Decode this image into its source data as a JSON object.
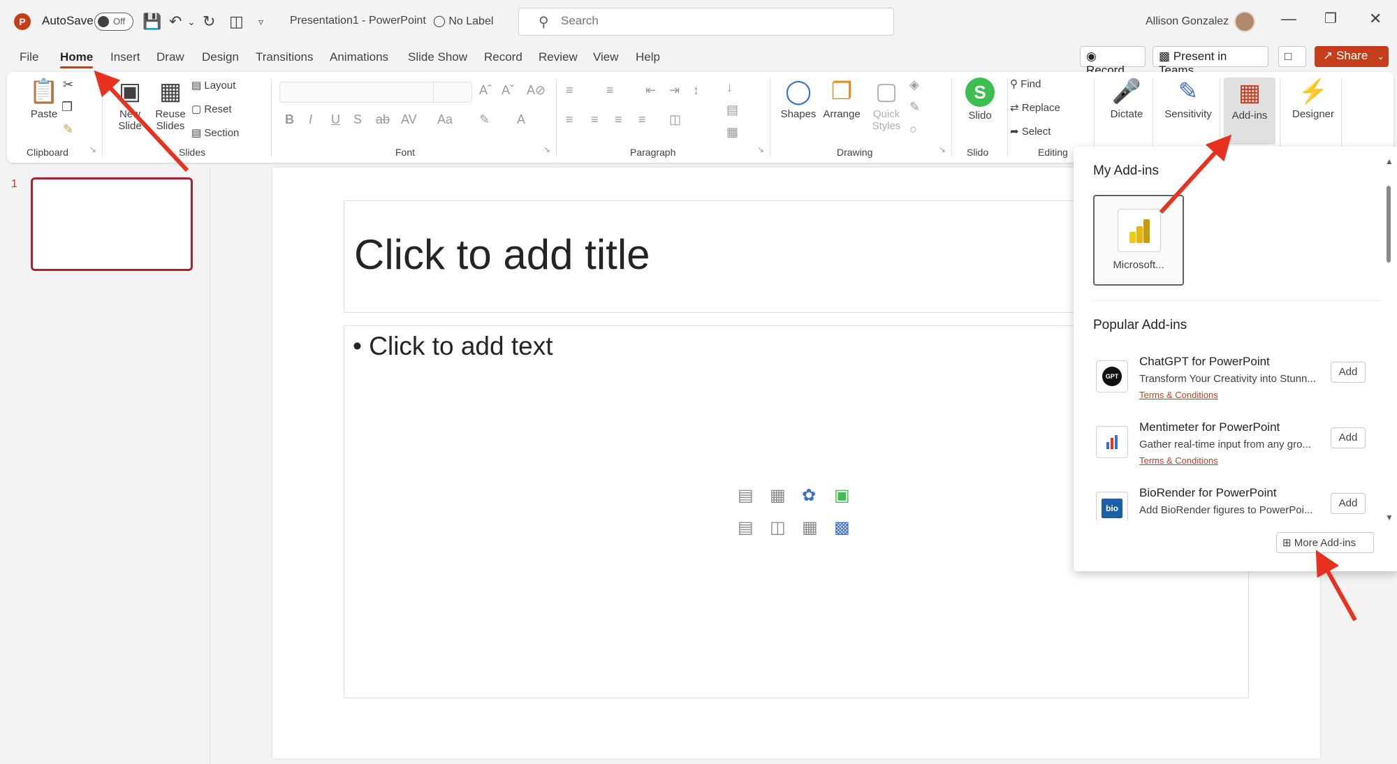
{
  "titlebar": {
    "app_logo": "P",
    "autosave_label": "AutoSave",
    "autosave_state": "Off",
    "doc_title": "Presentation1  -  PowerPoint",
    "sensitivity_label": "No Label",
    "search_placeholder": "Search",
    "user_name": "Allison Gonzalez"
  },
  "menu": {
    "tabs": [
      "File",
      "Home",
      "Insert",
      "Draw",
      "Design",
      "Transitions",
      "Animations",
      "Slide Show",
      "Record",
      "Review",
      "View",
      "Help"
    ],
    "active_tab": "Home",
    "record_label": "Record",
    "present_teams_label": "Present in Teams",
    "share_label": "Share"
  },
  "ribbon": {
    "clipboard": {
      "paste": "Paste",
      "group": "Clipboard"
    },
    "slides": {
      "new_slide_1": "New",
      "new_slide_2": "Slide",
      "reuse_1": "Reuse",
      "reuse_2": "Slides",
      "layout": "Layout",
      "reset": "Reset",
      "section": "Section",
      "group": "Slides"
    },
    "font": {
      "group": "Font"
    },
    "paragraph": {
      "group": "Paragraph"
    },
    "drawing": {
      "shapes": "Shapes",
      "arrange": "Arrange",
      "quick_1": "Quick",
      "quick_2": "Styles",
      "group": "Drawing"
    },
    "slido": {
      "label": "Slido",
      "group": "Slido"
    },
    "editing": {
      "find": "Find",
      "replace": "Replace",
      "select": "Select",
      "group": "Editing"
    },
    "dictate": "Dictate",
    "sensitivity": "Sensitivity",
    "addins": "Add-ins",
    "designer": "Designer"
  },
  "thumbnails": {
    "slide_number": "1"
  },
  "slide": {
    "title_placeholder": "Click to add title",
    "body_placeholder": "Click to add text"
  },
  "addins_panel": {
    "my_heading": "My Add-ins",
    "my_tile_label": "Microsoft...",
    "popular_heading": "Popular Add-ins",
    "items": [
      {
        "name": "ChatGPT for PowerPoint",
        "desc": "Transform Your Creativity into Stunn...",
        "terms": "Terms & Conditions",
        "add": "Add",
        "logo_text": "GPT"
      },
      {
        "name": "Mentimeter for PowerPoint",
        "desc": "Gather real-time input from any gro...",
        "terms": "Terms & Conditions",
        "add": "Add",
        "logo_text": ""
      },
      {
        "name": "BioRender for PowerPoint",
        "desc": "Add BioRender figures to PowerPoi...",
        "terms": "",
        "add": "Add",
        "logo_text": "bio"
      }
    ],
    "more_label": "More Add-ins"
  },
  "colors": {
    "accent": "#c43e1c",
    "annotation_arrow": "#e8321f",
    "slido_green": "#3dbe50"
  }
}
